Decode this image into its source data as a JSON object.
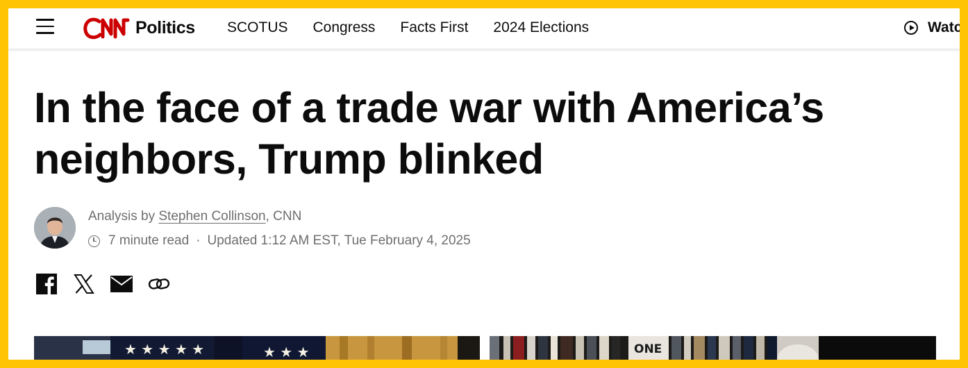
{
  "header": {
    "logo_text": "CNN",
    "section": "Politics",
    "nav": [
      "SCOTUS",
      "Congress",
      "Facts First",
      "2024 Elections"
    ],
    "watch_label": "Watch"
  },
  "article": {
    "headline": "In the face of a trade war with America’s neighbors, Trump blinked",
    "byline_prefix": "Analysis by ",
    "author": "Stephen Collinson",
    "outlet": ", CNN",
    "read_time": "7 minute read",
    "separator": "·",
    "updated": "Updated 1:12 AM EST, Tue February 4, 2025"
  },
  "share_icons": [
    "facebook-icon",
    "x-icon",
    "email-icon",
    "link-icon"
  ],
  "colors": {
    "frame": "#ffc505",
    "cnn_red": "#cc0000",
    "text": "#0c0c0c",
    "meta": "#6e6e6e"
  },
  "media": {
    "right_image_text": "ONE"
  }
}
